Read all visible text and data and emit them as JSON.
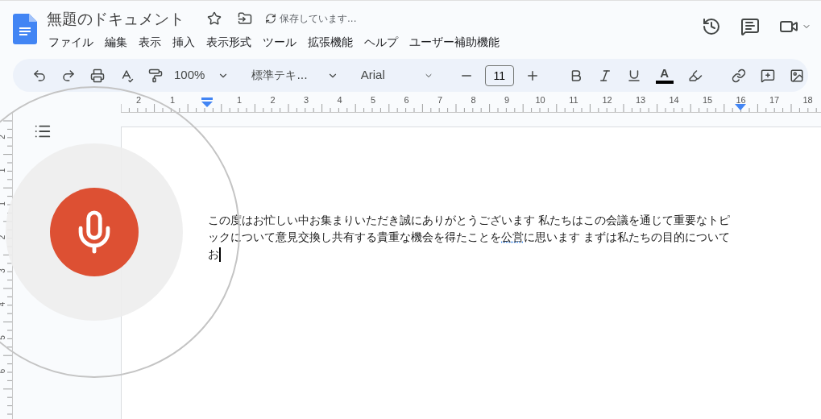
{
  "document": {
    "title": "無題のドキュメント",
    "save_status": "保存しています..."
  },
  "menu": [
    "ファイル",
    "編集",
    "表示",
    "挿入",
    "表示形式",
    "ツール",
    "拡張機能",
    "ヘルプ",
    "ユーザー補助機能"
  ],
  "toolbar": {
    "zoom": "100%",
    "style": "標準テキ...",
    "font": "Arial",
    "font_size": "11",
    "text_color_label": "A"
  },
  "ruler": {
    "horizontal": [
      "2",
      "1",
      "1",
      "2",
      "3",
      "4",
      "5",
      "6",
      "7",
      "8",
      "9",
      "10",
      "11",
      "12",
      "13",
      "14",
      "15",
      "16",
      "17",
      "18"
    ],
    "vertical": [
      "2",
      "1",
      "1",
      "2",
      "3",
      "4",
      "5",
      "6"
    ]
  },
  "voice_typing": {
    "listening": true
  },
  "paragraph": [
    {
      "text": "この度はお忙しい中お集まりいただき誠にありがとうございます 私たちはこの会議を通じて重要なトピックについて意見交換し共有する貴重な機会を得たことを",
      "flagged": false
    },
    {
      "text": "公営",
      "flagged": true
    },
    {
      "text": "に思います まずは私たちの目的についてお",
      "flagged": false
    }
  ]
}
